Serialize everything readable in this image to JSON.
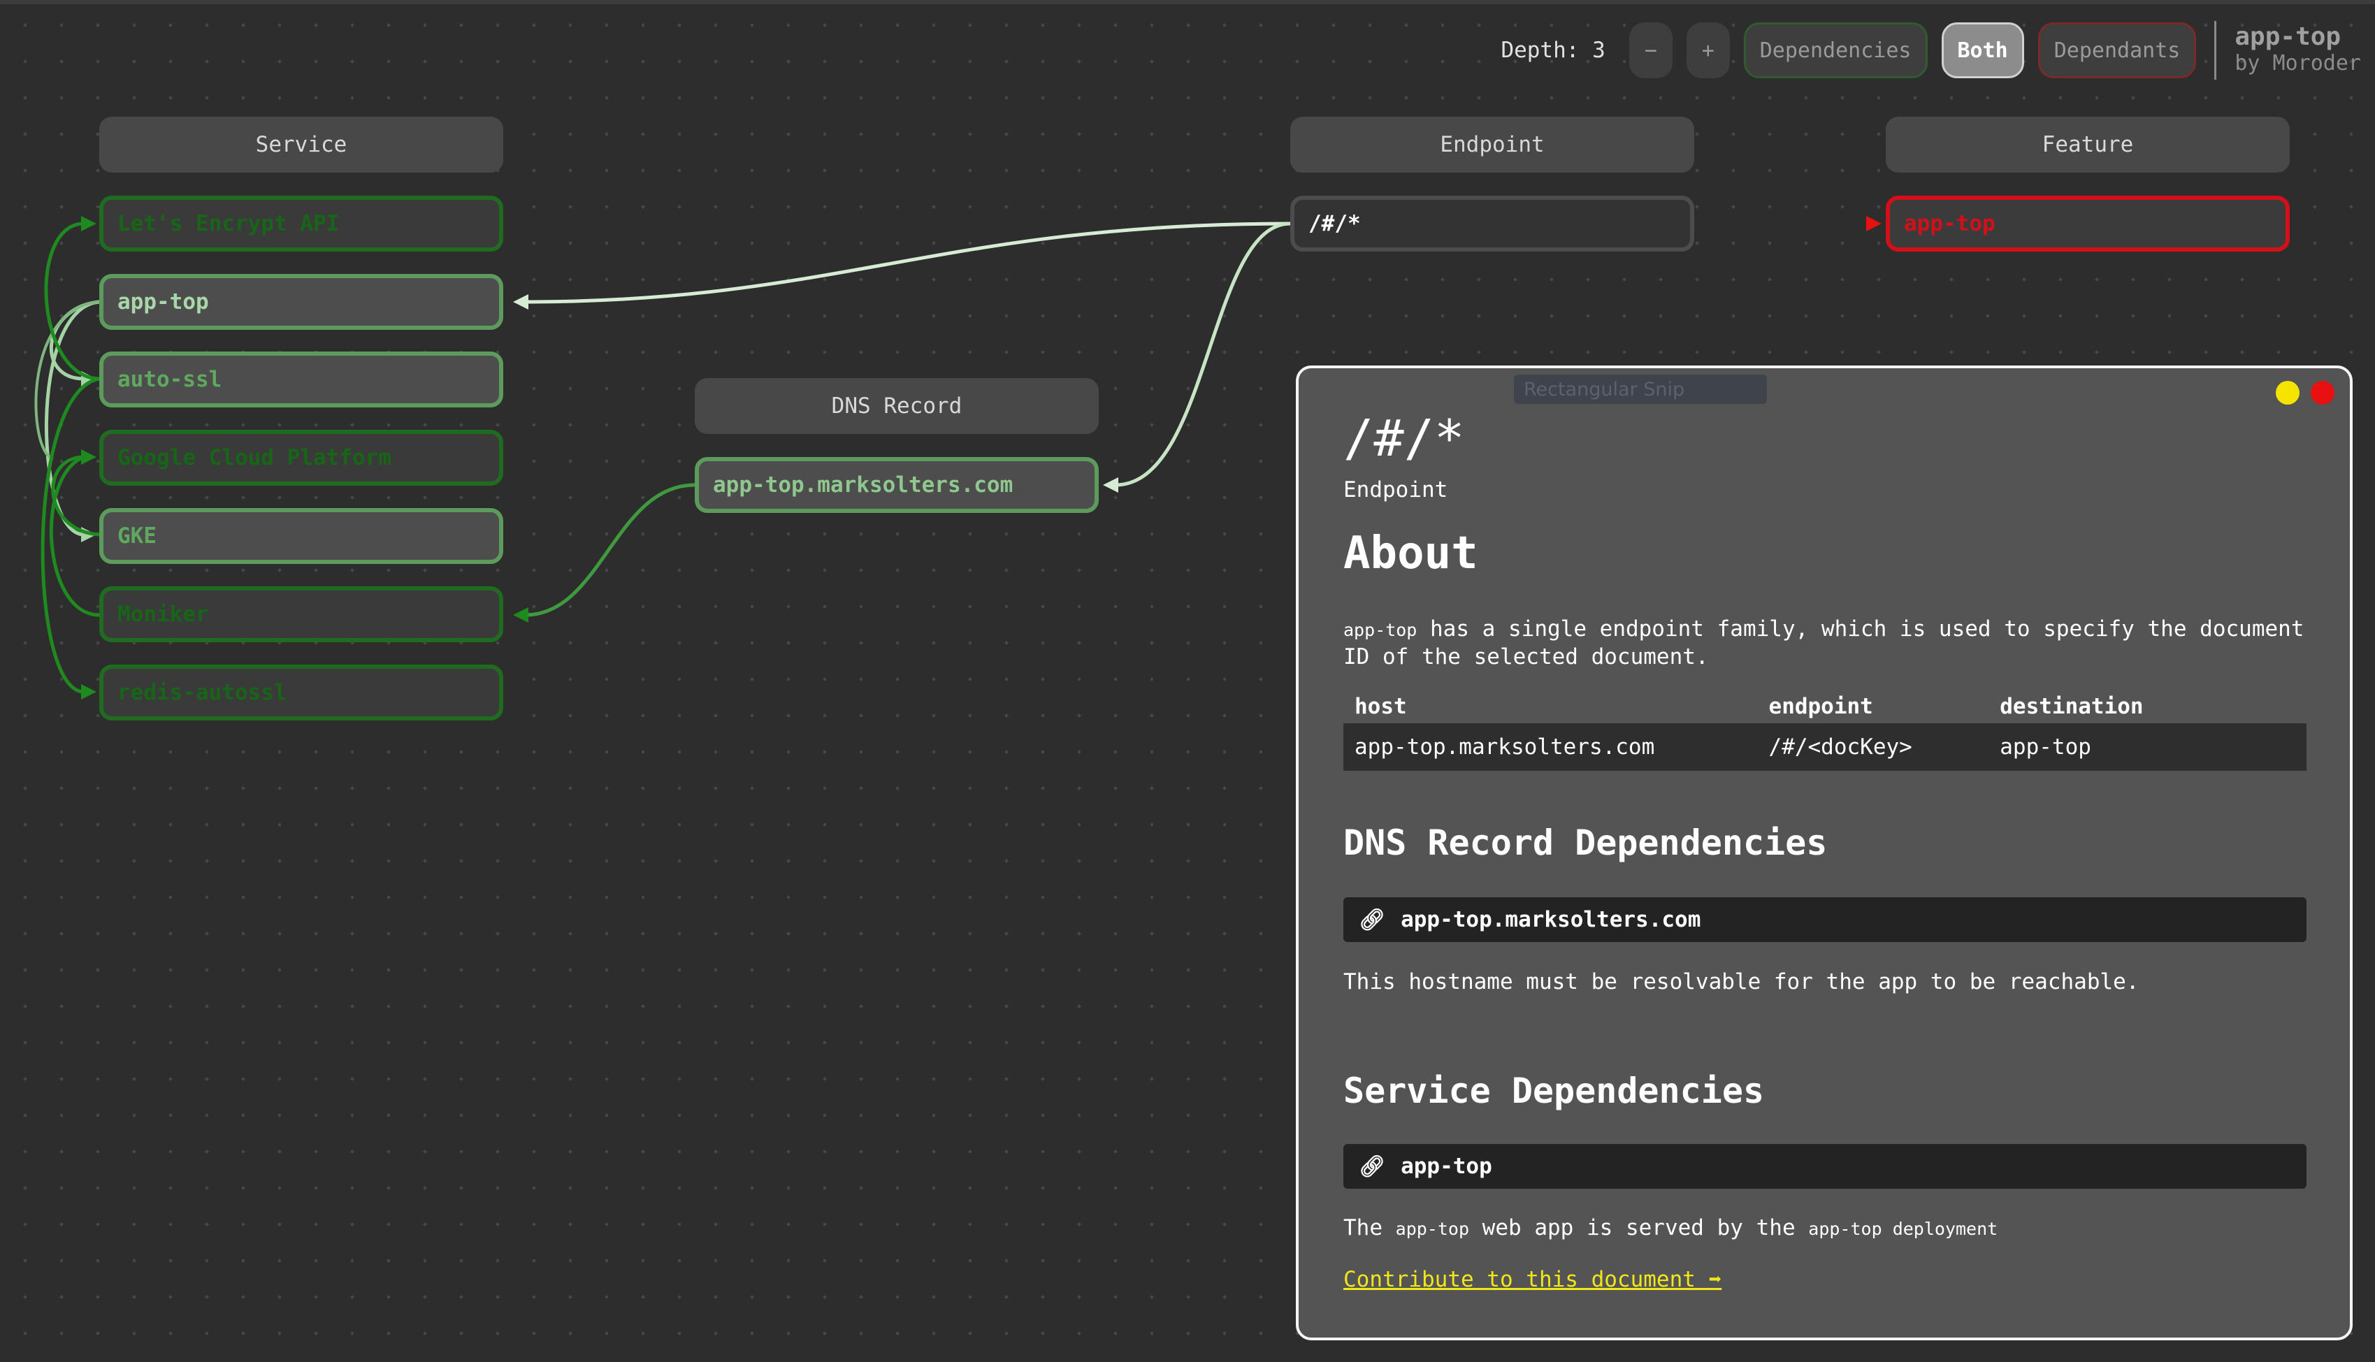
{
  "toolbar": {
    "depth_label": "Depth: 3",
    "minus": "−",
    "plus": "+",
    "dependencies": "Dependencies",
    "both": "Both",
    "dependants": "Dependants"
  },
  "brand": {
    "title": "app-top",
    "by": "by Moroder"
  },
  "columns": {
    "service": "Service",
    "dns": "DNS Record",
    "endpoint": "Endpoint",
    "feature": "Feature"
  },
  "nodes": {
    "services": [
      "Let's Encrypt API",
      "app-top",
      "auto-ssl",
      "Google Cloud Platform",
      "GKE",
      "Moniker",
      "redis-autossl"
    ],
    "dns": "app-top.marksolters.com",
    "endpoint": "/#/*",
    "feature": "app-top"
  },
  "tooltip": "Rectangular Snip",
  "panel": {
    "title": "/#/*",
    "type": "Endpoint",
    "about_heading": "About",
    "about_code": "app-top",
    "about_text": " has a single endpoint family, which is used to specify the document ID of the selected document.",
    "table": {
      "headers": [
        "host",
        "endpoint",
        "destination"
      ],
      "rows": [
        [
          "app-top.marksolters.com",
          "/#/<docKey>",
          "app-top"
        ]
      ]
    },
    "dns_heading": "DNS Record Dependencies",
    "dns_item": "app-top.marksolters.com",
    "dns_note": "This hostname must be resolvable for the app to be reachable.",
    "service_heading": "Service Dependencies",
    "service_item": "app-top",
    "service_note": {
      "p1": "The ",
      "code1": "app-top",
      "p2": " web app is served by the ",
      "code2": "app-top",
      "p3": " deployment"
    },
    "contribute": "Contribute to this document ➡"
  },
  "colors": {
    "background": "#2d2d2d",
    "dependency_dark": "#1f6b1f",
    "dependency_light": "#a9d7a9",
    "dependant": "#d3101a",
    "panel": "#545454",
    "link": "#f1e61a"
  }
}
